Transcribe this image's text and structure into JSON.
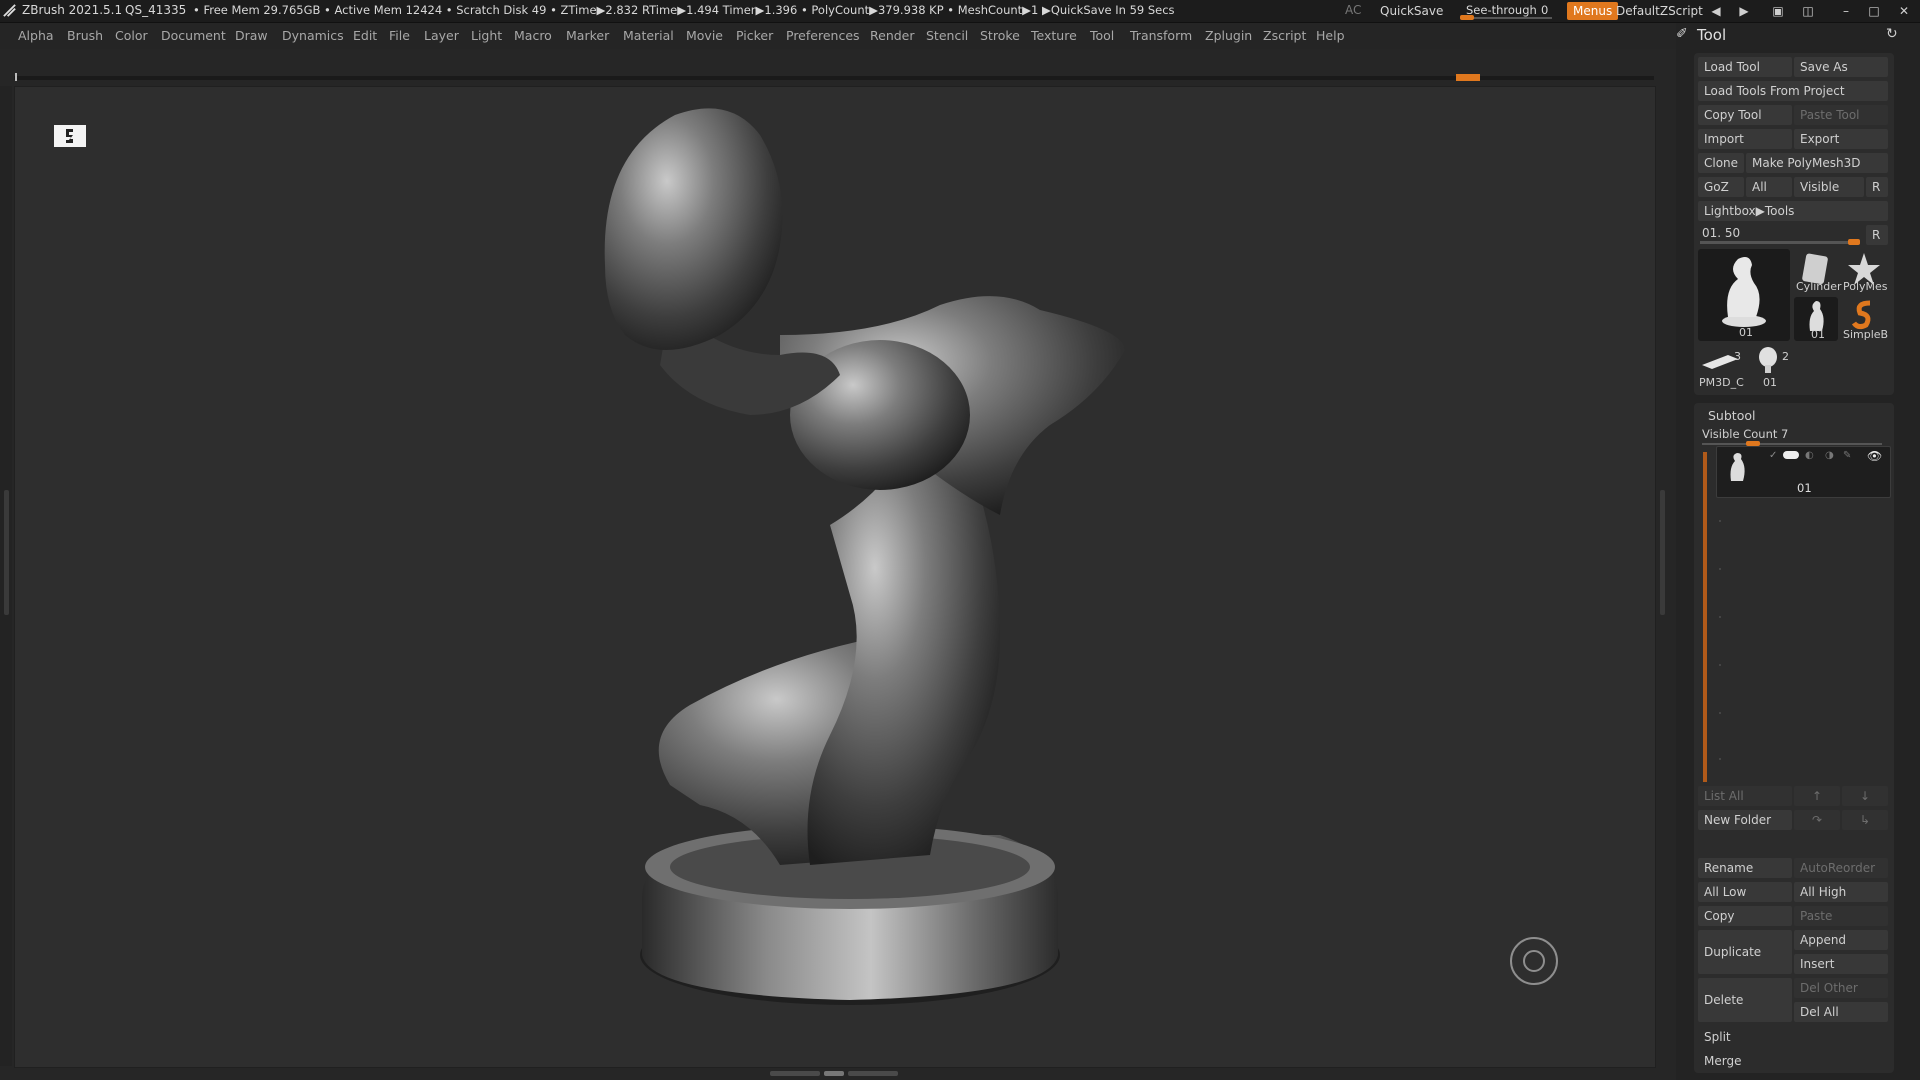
{
  "titlebar": {
    "app": "ZBrush 2021.5.1",
    "session": "QS_41335",
    "stats": "• Free Mem 29.765GB • Active Mem 12424 • Scratch Disk 49 •  ZTime▶2.832 RTime▶1.494 Timer▶1.396 • PolyCount▶379.938 KP  • MeshCount▶1  ▶QuickSave In 59 Secs",
    "ac": "AC",
    "quicksave": "QuickSave",
    "seethrough_label": "See-through",
    "seethrough_value": "0",
    "seethrough_level": 0,
    "menus": "Menus",
    "script": "DefaultZScript"
  },
  "menubar": [
    "Alpha",
    "Brush",
    "Color",
    "Document",
    "Draw",
    "Dynamics",
    "Edit",
    "File",
    "Layer",
    "Light",
    "Macro",
    "Marker",
    "Material",
    "Movie",
    "Picker",
    "Preferences",
    "Render",
    "Stencil",
    "Stroke",
    "Texture",
    "Tool",
    "Transform",
    "Zplugin",
    "Zscript",
    "Help"
  ],
  "tool_panel": {
    "title": "Tool",
    "load_tool": "Load Tool",
    "save_as": "Save As",
    "load_from_project": "Load Tools From Project",
    "copy_tool": "Copy Tool",
    "paste_tool": "Paste Tool",
    "import": "Import",
    "export": "Export",
    "clone": "Clone",
    "make_polymesh": "Make PolyMesh3D",
    "goz": "GoZ",
    "all": "All",
    "visible": "Visible",
    "r": "R",
    "lightbox_tools": "Lightbox▶Tools",
    "tool_slider": "01. 50",
    "tool_slider_level": 0.93,
    "thumbs": {
      "main": "01",
      "cylinder": "Cylinder",
      "polymesh": "PolyMes",
      "small01": "01",
      "simpleb": "SimpleB",
      "pm3d": "PM3D_C",
      "pm3d_count": "3",
      "head": "01",
      "head_count": "2"
    }
  },
  "subtool": {
    "title": "Subtool",
    "visible_count": "Visible Count 7",
    "item_name": "01",
    "list_all": "List All",
    "new_folder": "New Folder",
    "rename": "Rename",
    "autoreorder": "AutoReorder",
    "all_low": "All Low",
    "all_high": "All High",
    "copy": "Copy",
    "paste": "Paste",
    "duplicate": "Duplicate",
    "append": "Append",
    "insert": "Insert",
    "delete": "Delete",
    "del_other": "Del Other",
    "del_all": "Del All",
    "split": "Split",
    "merge": "Merge"
  },
  "colors": {
    "accent": "#e0781e",
    "canvas": "#2e2e2e",
    "panel": "#232323"
  }
}
